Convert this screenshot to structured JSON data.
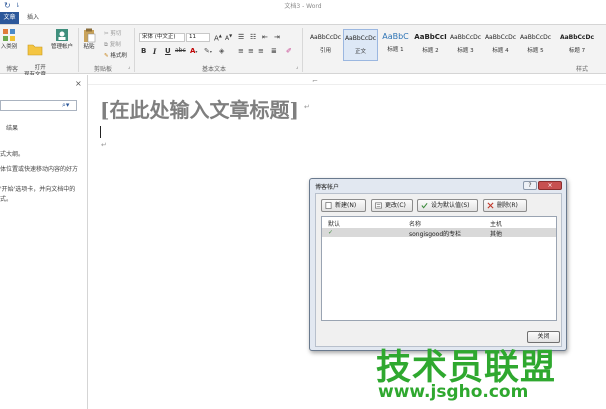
{
  "window": {
    "doc_title": "文档3 - Word"
  },
  "tabs": [
    {
      "label": "文章"
    },
    {
      "label": "插入"
    }
  ],
  "ribbon": {
    "blog_group": {
      "label": "博客",
      "buttons": [
        {
          "label": "入类别"
        },
        {
          "label": "打开\n现有文章"
        },
        {
          "label": "管理帐户"
        }
      ]
    },
    "clipboard_group": {
      "label": "剪贴板",
      "paste": "粘贴",
      "cut": "剪切",
      "copy": "复制",
      "format_painter": "格式刷"
    },
    "font_group": {
      "label": "基本文本",
      "font_name": "宋体 (中文正)",
      "font_size": "11",
      "bold": "B",
      "italic": "I",
      "underline": "U",
      "strike": "abc"
    },
    "styles_group": {
      "label": "样式",
      "items": [
        {
          "preview": "AaBbCcDc",
          "name": "引用"
        },
        {
          "preview": "AaBbCcDc",
          "name": "正文"
        },
        {
          "preview": "AaBbC",
          "name": "标题 1"
        },
        {
          "preview": "AaBbCcI",
          "name": "标题 2"
        },
        {
          "preview": "AaBbCcDc",
          "name": "标题 3"
        },
        {
          "preview": "AaBbCcDc",
          "name": "标题 4"
        },
        {
          "preview": "AaBbCcDc",
          "name": "标题 5"
        },
        {
          "preview": "AaBbCcDc",
          "name": "标题 7"
        }
      ]
    }
  },
  "nav_pane": {
    "close": "×",
    "results_label": "结果",
    "text_lines": [
      "式大纲。",
      "体位置或快速移动内容的好方",
      "",
      "'开始'选项卡，并向文档中的",
      "式。"
    ]
  },
  "document": {
    "title_placeholder": "[在此处输入文章标题]"
  },
  "dialog": {
    "title": "博客帐户",
    "help": "?",
    "close": "×",
    "buttons": {
      "new": "新建(N)",
      "change": "更改(C)",
      "set_default": "设为默认值(S)",
      "delete": "删除(R)"
    },
    "columns": {
      "default": "默认",
      "name": "名称",
      "host": "主机"
    },
    "accounts": [
      {
        "default": "✓",
        "name": "songisgood的专栏",
        "host": "其他"
      }
    ],
    "close_button": "关闭"
  },
  "watermark": {
    "logo": "技术员联盟",
    "url": "www.jsgho.com"
  },
  "colors": {
    "ribbon_accent": "#2b579a",
    "watermark": "#2fa82f",
    "dialog_frame": "#e2e8f1"
  }
}
